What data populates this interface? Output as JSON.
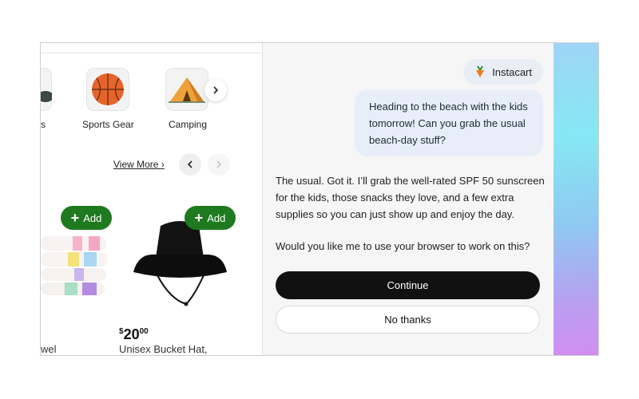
{
  "shop": {
    "categories": [
      {
        "label": "s",
        "icon": "partial-category-icon"
      },
      {
        "label": "Sports Gear",
        "icon": "basketball-icon"
      },
      {
        "label": "Camping",
        "icon": "tent-icon"
      }
    ],
    "view_more_label": "View More",
    "view_more_chevron": "›",
    "products": [
      {
        "add_label": "Add",
        "name": "wel",
        "icon": "striped-towel-icon"
      },
      {
        "add_label": "Add",
        "price_currency": "$",
        "price_whole": "20",
        "price_cents": "00",
        "name": "Unisex Bucket Hat,",
        "icon": "bucket-hat-icon"
      }
    ]
  },
  "chat": {
    "pill_label": "Instacart",
    "user_message": "Heading to the beach with the kids tomorrow! Can you grab the usual beach-day stuff?",
    "assistant_message": "The usual. Got it. I’ll grab the well-rated SPF 50 sunscreen for the kids, those snacks they love, and a few extra supplies so you can just show up and enjoy the day.",
    "assistant_question": "Would you like me to use your browser to work on this?",
    "continue_label": "Continue",
    "no_thanks_label": "No thanks"
  },
  "colors": {
    "add_button": "#1f7a1f",
    "primary_button": "#111111",
    "user_bubble": "#e7eef8"
  }
}
